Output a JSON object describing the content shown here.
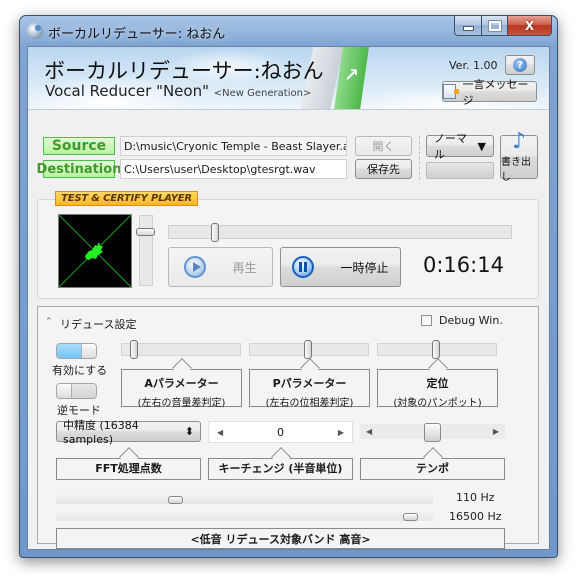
{
  "window": {
    "title": "ボーカルリデューサー: ねおん",
    "controls": {
      "minimize": "minimize",
      "maximize": "maximize",
      "close": "X"
    }
  },
  "banner": {
    "title_jp": "ボーカルリデューサー:ねおん",
    "title_en": "Vocal Reducer \"Neon\"",
    "subtitle": "<New Generation>",
    "version": "Ver. 1.00",
    "help_label": "?",
    "message_label": "一言メッセージ"
  },
  "io": {
    "source_label": "Source",
    "source_path": "D:\\music\\Cryonic Temple - Beast Slayer.aac",
    "destination_label": "Destination",
    "destination_path": "C:\\Users\\user\\Desktop\\gtesrgt.wav",
    "open_label": "開く",
    "saveto_label": "保存先",
    "mode_value": "ノーマル",
    "export_label": "書き出し"
  },
  "player": {
    "tag": "TEST & CERTIFY PLAYER",
    "play_label": "再生",
    "pause_label": "一時停止",
    "time": "0:16:14",
    "seek_position": 0.13,
    "volume_level": 0.85
  },
  "reduce": {
    "title": "リデュース設定",
    "debug_label": "Debug Win.",
    "debug_checked": false,
    "enable_label": "有効にする",
    "enable_on": true,
    "reverse_label": "逆モード",
    "reverse_on": false,
    "params": [
      {
        "title": "Aパラメーター",
        "subtitle": "(左右の音量差判定)",
        "position": 0.1
      },
      {
        "title": "Pパラメーター",
        "subtitle": "(左右の位相差判定)",
        "position": 0.5
      },
      {
        "title": "定位",
        "subtitle": "(対象のパンポット)",
        "position": 0.5
      }
    ],
    "fft_value": "中精度 (16384 samples)",
    "fft_caption": "FFT処理点数",
    "key_value": "0",
    "key_caption": "キーチェンジ (半音単位)",
    "tempo_caption": "テンポ",
    "tempo_position": 0.5,
    "band_low": "110 Hz",
    "band_high": "16500 Hz",
    "band_low_position": 0.31,
    "band_high_position": 0.93,
    "band_caption": "<低音  リデュース対象バンド  高音>"
  }
}
